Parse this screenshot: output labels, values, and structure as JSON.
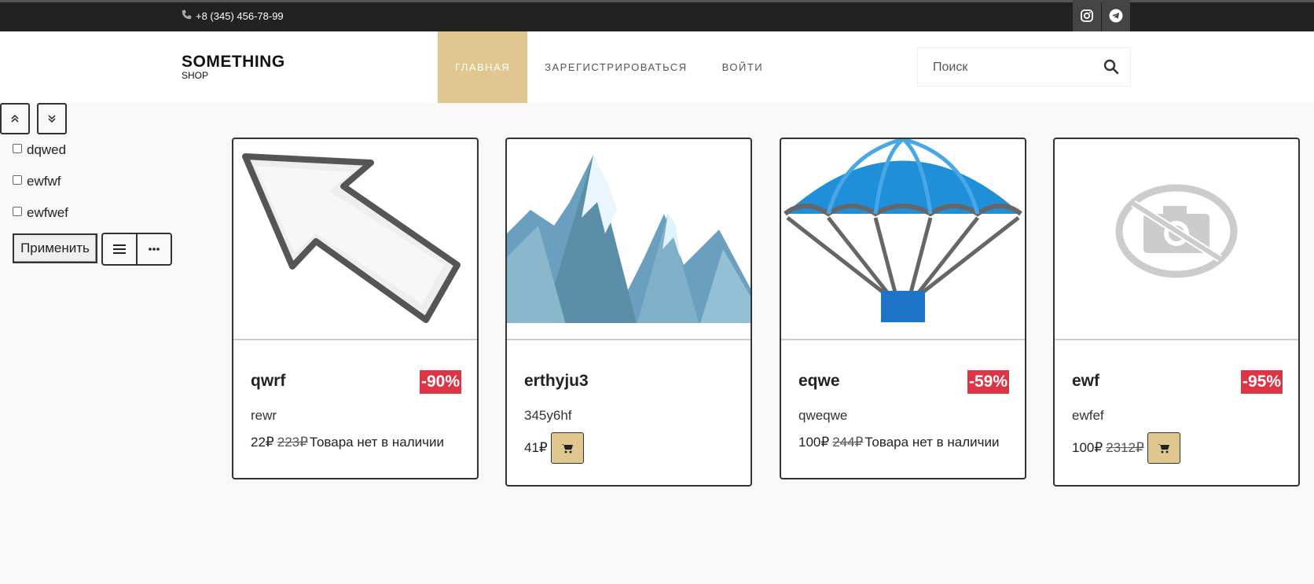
{
  "topbar": {
    "phone": "+8 (345) 456-78-99",
    "social": [
      {
        "icon": "instagram-icon"
      },
      {
        "icon": "telegram-icon"
      }
    ]
  },
  "header": {
    "logo_main": "SOMETHING",
    "logo_sub": "SHOP",
    "nav": [
      {
        "label": "ГЛАВНАЯ",
        "active": true
      },
      {
        "label": "ЗАРЕГИСТРИРОВАТЬСЯ",
        "active": false
      },
      {
        "label": "ВОЙТИ",
        "active": false
      }
    ],
    "search": {
      "placeholder": "Поиск",
      "value": ""
    }
  },
  "sidebar": {
    "filters": [
      {
        "label": "dqwed",
        "checked": false
      },
      {
        "label": "ewfwf",
        "checked": false
      },
      {
        "label": "ewfwef",
        "checked": false
      }
    ],
    "apply_label": "Применить"
  },
  "products": [
    {
      "name": "qwrf",
      "discount": "-90%",
      "description": "rewr",
      "price": "22₽",
      "old_price": "223₽",
      "status": "Товара нет в наличии",
      "image": "arrow-cursor-image"
    },
    {
      "name": "erthyju3",
      "discount": "",
      "description": "345y6hf",
      "price": "41₽",
      "old_price": "",
      "status": "",
      "image": "mountains-image"
    },
    {
      "name": "eqwe",
      "discount": "-59%",
      "description": "qweqwe",
      "price": "100₽",
      "old_price": "244₽",
      "status": "Товара нет в наличии",
      "image": "parachute-image"
    },
    {
      "name": "ewf",
      "discount": "-95%",
      "description": "ewfef",
      "price": "100₽",
      "old_price": "2312₽",
      "status": "",
      "image": "no-photo-image"
    }
  ],
  "colors": {
    "accent": "#dfc78f",
    "discount": "#dc3545",
    "topbar": "#222222"
  }
}
